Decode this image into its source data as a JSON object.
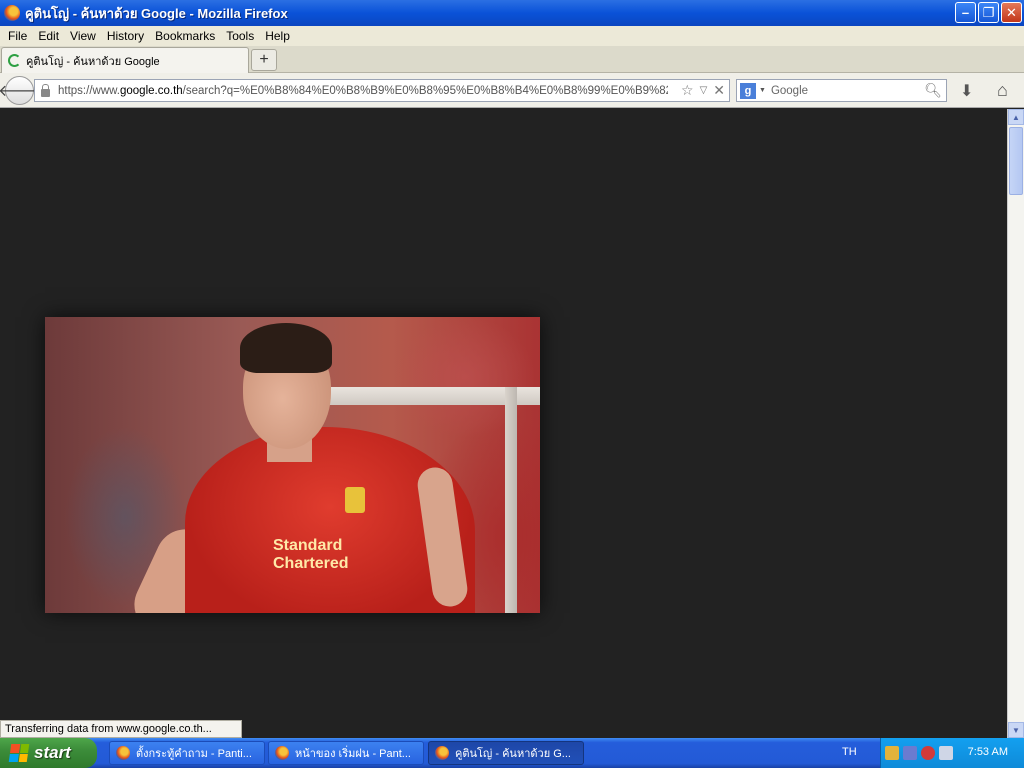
{
  "window": {
    "title": "คูตินโญ่ - ค้นหาด้วย Google - Mozilla Firefox"
  },
  "menu": [
    "File",
    "Edit",
    "View",
    "History",
    "Bookmarks",
    "Tools",
    "Help"
  ],
  "tab": {
    "title": "คูตินโญ่ - ค้นหาด้วย Google",
    "newtab_label": "+"
  },
  "nav": {
    "url_prefix": "https://www.",
    "url_host": "google.co.th",
    "url_path": "/search?q=%E0%B8%84%E0%B8%B9%E0%B8%95%E0%B8%B4%E0%B8%99%E0%B9%82%E",
    "search_placeholder": "Google"
  },
  "content": {
    "photo_sponsor_line1": "Standard",
    "photo_sponsor_line2": "Chartered"
  },
  "status": {
    "text": "Transferring data from www.google.co.th..."
  },
  "taskbar": {
    "start_label": "start",
    "tasks": [
      {
        "label": "ตั้งกระทู้คำถาม - Panti..."
      },
      {
        "label": "หน้าของ เริ่มฝน - Pant..."
      },
      {
        "label": "คูตินโญ่ - ค้นหาด้วย G..."
      }
    ],
    "language": "TH",
    "clock": "7:53 AM"
  }
}
